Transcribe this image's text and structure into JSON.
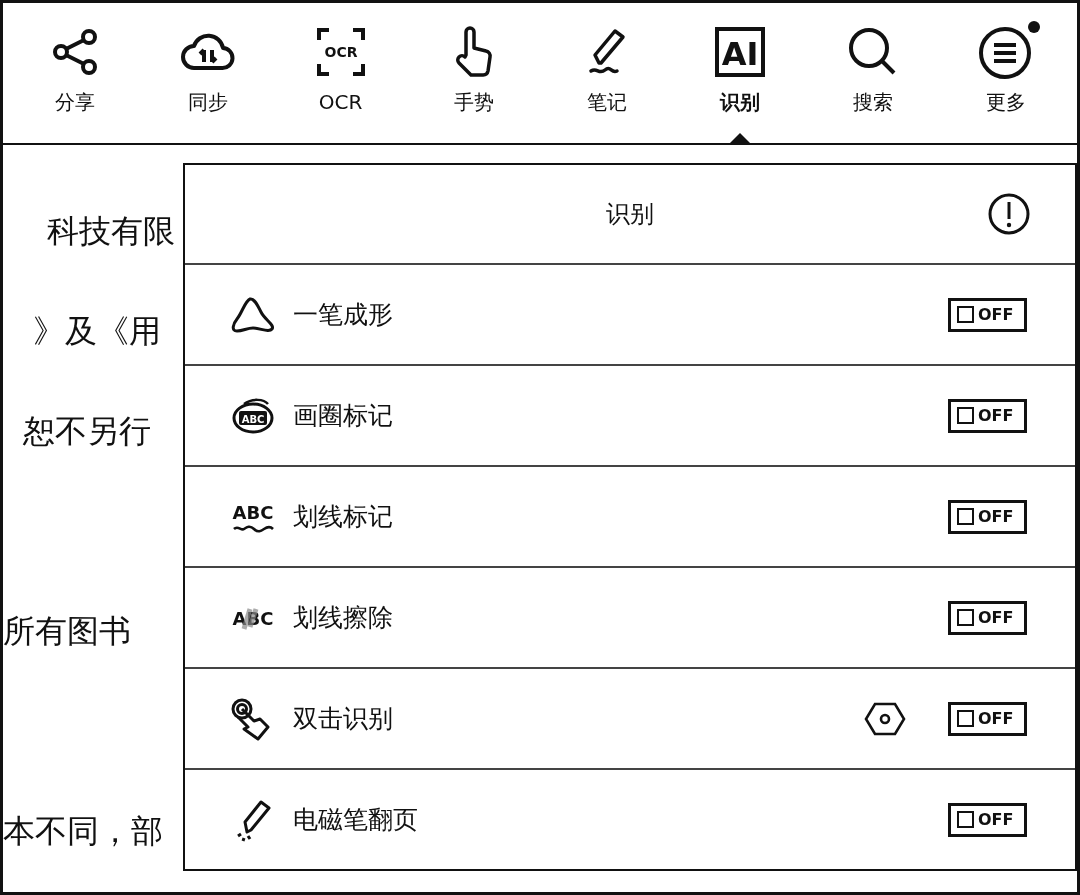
{
  "toolbar": {
    "items": [
      {
        "label": "分享",
        "selected": false,
        "badge": false
      },
      {
        "label": "同步",
        "selected": false,
        "badge": false
      },
      {
        "label": "OCR",
        "selected": false,
        "badge": false,
        "icon_text": "OCR"
      },
      {
        "label": "手势",
        "selected": false,
        "badge": false
      },
      {
        "label": "笔记",
        "selected": false,
        "badge": false
      },
      {
        "label": "识别",
        "selected": true,
        "badge": false,
        "icon_text": "AI"
      },
      {
        "label": "搜索",
        "selected": false,
        "badge": false
      },
      {
        "label": "更多",
        "selected": false,
        "badge": true
      }
    ]
  },
  "page_text": [
    "科技有限",
    "》及《用",
    "恕不另行",
    "所有图书",
    "本不同，部"
  ],
  "panel": {
    "title": "识别",
    "options": [
      {
        "label": "一笔成形",
        "on": false,
        "state_text": "OFF",
        "settings": false
      },
      {
        "label": "画圈标记",
        "on": false,
        "state_text": "OFF",
        "settings": false,
        "icon_text": "ABC"
      },
      {
        "label": "划线标记",
        "on": false,
        "state_text": "OFF",
        "settings": false,
        "icon_text": "ABC"
      },
      {
        "label": "划线擦除",
        "on": false,
        "state_text": "OFF",
        "settings": false,
        "icon_text": "ABC"
      },
      {
        "label": "双击识别",
        "on": false,
        "state_text": "OFF",
        "settings": true
      },
      {
        "label": "电磁笔翻页",
        "on": false,
        "state_text": "OFF",
        "settings": false
      }
    ]
  }
}
